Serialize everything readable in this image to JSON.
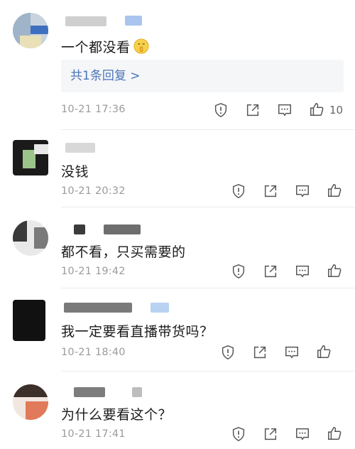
{
  "comments": [
    {
      "text": "一个都没看",
      "has_emoji": true,
      "reply_link": "共1条回复 >",
      "time": "10-21 17:36",
      "likes": "10"
    },
    {
      "text": "没钱",
      "time": "10-21 20:32",
      "likes": ""
    },
    {
      "text": "都不看，只买需要的",
      "time": "10-21 19:42",
      "likes": ""
    },
    {
      "text": "我一定要看直播带货吗？",
      "time": "10-21 18:40",
      "likes": ""
    },
    {
      "text": "为什么要看这个？",
      "time": "10-21 17:41",
      "likes": ""
    }
  ],
  "icons": {
    "report": "report-shield-icon",
    "share": "share-arrow-icon",
    "reply": "reply-bubble-icon",
    "like": "thumbs-up-icon",
    "emoji": "shushing-face-emoji-icon"
  },
  "colors": {
    "reply_link": "#4a74b8",
    "time": "#9b9b9b",
    "icon": "#555555"
  }
}
